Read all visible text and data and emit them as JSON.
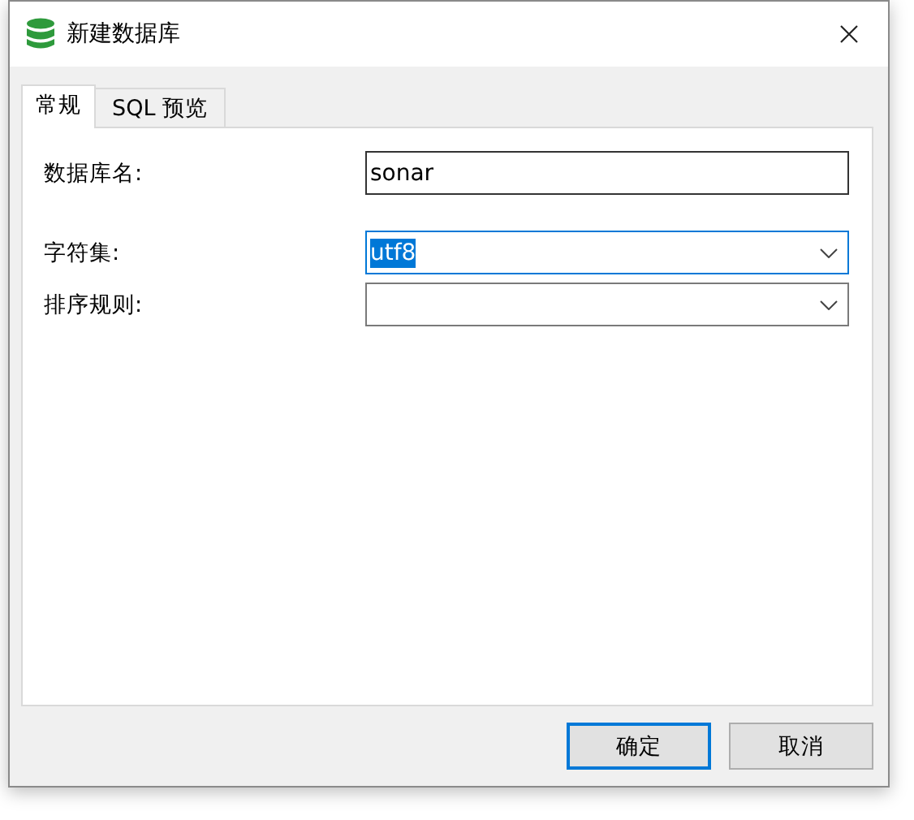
{
  "window": {
    "title": "新建数据库"
  },
  "tabs": [
    {
      "label": "常规",
      "selected": true
    },
    {
      "label": "SQL 预览",
      "selected": false
    }
  ],
  "fields": [
    {
      "kind": "text",
      "label": "数据库名:",
      "value": "sonar",
      "focused": false
    },
    {
      "kind": "select",
      "label": "字符集:",
      "value": "utf8",
      "focused": true,
      "text_selected": true
    },
    {
      "kind": "select",
      "label": "排序规则:",
      "focused": false
    }
  ],
  "buttons": [
    {
      "label": "确定",
      "default": true
    },
    {
      "label": "取消",
      "default": false
    }
  ]
}
